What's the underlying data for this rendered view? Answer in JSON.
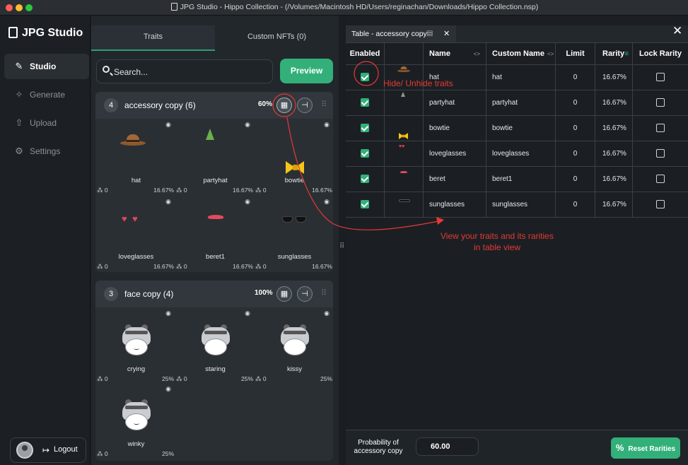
{
  "window": {
    "title": "JPG Studio - Hippo Collection - (/Volumes/Macintosh HD/Users/reginachan/Downloads/Hippo Collection.nsp)"
  },
  "sidebar": {
    "brand": "JPG Studio",
    "items": [
      {
        "label": "Studio",
        "icon": "brush-icon",
        "active": true
      },
      {
        "label": "Generate",
        "icon": "sparkle-icon",
        "active": false
      },
      {
        "label": "Upload",
        "icon": "upload-icon",
        "active": false
      },
      {
        "label": "Settings",
        "icon": "gear-icon",
        "active": false
      }
    ],
    "logout_label": "Logout"
  },
  "traits_panel": {
    "tabs": [
      "Traits",
      "Custom NFTs (0)"
    ],
    "search_placeholder": "Search...",
    "preview_label": "Preview",
    "groups": [
      {
        "number": "4",
        "name": "accessory copy (6)",
        "percent": "60%",
        "traits": [
          {
            "name": "hat",
            "count": "0",
            "rarity": "16.67%"
          },
          {
            "name": "partyhat",
            "count": "0",
            "rarity": "16.67%"
          },
          {
            "name": "bowtie",
            "count": "0",
            "rarity": "16.67%"
          },
          {
            "name": "loveglasses",
            "count": "0",
            "rarity": "16.67%"
          },
          {
            "name": "beret1",
            "count": "0",
            "rarity": "16.67%"
          },
          {
            "name": "sunglasses",
            "count": "0",
            "rarity": "16.67%"
          }
        ]
      },
      {
        "number": "3",
        "name": "face copy (4)",
        "percent": "100%",
        "traits": [
          {
            "name": "crying",
            "count": "0",
            "rarity": "25%"
          },
          {
            "name": "staring",
            "count": "0",
            "rarity": "25%"
          },
          {
            "name": "kissy",
            "count": "0",
            "rarity": "25%"
          },
          {
            "name": "winky",
            "count": "0",
            "rarity": "25%"
          }
        ]
      }
    ]
  },
  "table_panel": {
    "tab_label": "Table - accessory copy",
    "columns": [
      "Enabled",
      "",
      "Name",
      "Custom Name",
      "Limit",
      "Rarity",
      "Lock Rarity"
    ],
    "rows": [
      {
        "enabled": true,
        "name": "hat",
        "custom_name": "hat",
        "limit": "0",
        "rarity": "16.67%",
        "locked": false
      },
      {
        "enabled": true,
        "name": "partyhat",
        "custom_name": "partyhat",
        "limit": "0",
        "rarity": "16.67%",
        "locked": false
      },
      {
        "enabled": true,
        "name": "bowtie",
        "custom_name": "bowtie",
        "limit": "0",
        "rarity": "16.67%",
        "locked": false
      },
      {
        "enabled": true,
        "name": "loveglasses",
        "custom_name": "loveglasses",
        "limit": "0",
        "rarity": "16.67%",
        "locked": false
      },
      {
        "enabled": true,
        "name": "beret",
        "custom_name": "beret1",
        "limit": "0",
        "rarity": "16.67%",
        "locked": false
      },
      {
        "enabled": true,
        "name": "sunglasses",
        "custom_name": "sunglasses",
        "limit": "0",
        "rarity": "16.67%",
        "locked": false
      }
    ],
    "probability_label": "Probability of accessory copy",
    "probability_value": "60.00",
    "reset_label": "Reset Rarities"
  },
  "annotations": {
    "hide_unhide": "Hide/ Unhide traits",
    "table_view_line1": "View your traits and its rarities",
    "table_view_line2": "in table view"
  },
  "colors": {
    "accent": "#33b07a",
    "annotation": "#e53935",
    "background": "#1a1e22"
  }
}
